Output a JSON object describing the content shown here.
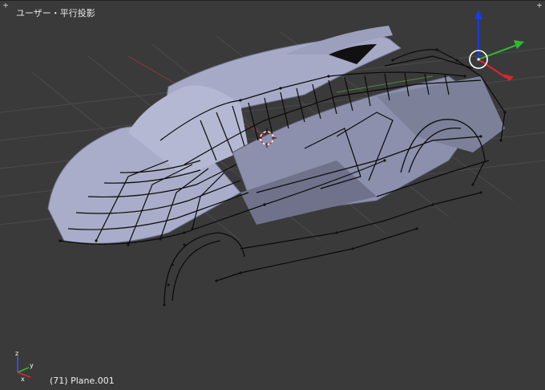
{
  "viewport": {
    "view_label": "ユーザー・平行投影",
    "status_label": "(71) Plane.001",
    "background_color": "#3a3a3a"
  },
  "controls": {
    "corner_left_symbol": "+",
    "corner_right_symbol": "+"
  },
  "gizmo": {
    "icon": "navigation-gizmo-icon",
    "colors": {
      "x": "#e0242a",
      "y": "#2fb82f",
      "z": "#1a3ae6"
    }
  },
  "mini_axes": {
    "icon": "axis-orientation-icon",
    "labels": {
      "x": "x",
      "y": "y",
      "z": "z"
    }
  },
  "model": {
    "icon": "car-mesh-icon",
    "shaded_color": "#a8acc8",
    "wire_color": "#0a0a0a"
  },
  "cursor_icon": "3d-cursor-icon"
}
